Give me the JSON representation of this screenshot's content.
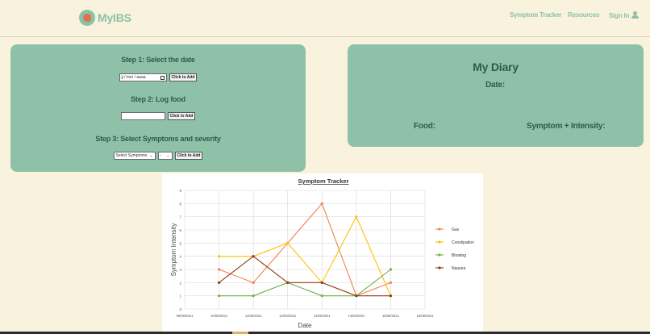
{
  "brand": {
    "name": "MyIBS"
  },
  "nav": {
    "symptom_tracker": "Symptom Tracker",
    "resources": "Resources",
    "sign_in": "Sign In"
  },
  "log_panel": {
    "step1_title": "Step 1: Select the date",
    "date_placeholder": "jj / mm / aaaa",
    "step1_button": "Click to Add",
    "step2_title": "Step 2: Log food",
    "food_value": "",
    "step2_button": "Click to Add",
    "step3_title": "Step 3: Select Symptoms and severity",
    "symptom_select": "Select Symptoms",
    "severity_select": "-",
    "step3_button": "Click to Add"
  },
  "diary": {
    "title": "My Diary",
    "date_label": "Date:",
    "food_label": "Food:",
    "symptom_label": "Symptom + Intensity:"
  },
  "chart_data": {
    "type": "line",
    "title": "Symptom Tracker",
    "xlabel": "Date",
    "ylabel": "Symptom Intensity",
    "x": [
      "09/09/2021",
      "10/09/2021",
      "11/09/2021",
      "12/09/2021",
      "13/09/2021",
      "14/09/2021",
      "15/09/2021",
      "16/09/2021"
    ],
    "ylim": [
      0,
      9
    ],
    "yticks": [
      "0",
      "1",
      "2",
      "3",
      "4",
      "5",
      "6",
      "7",
      "8",
      "9"
    ],
    "grid": true,
    "legend": "right",
    "series": [
      {
        "name": "Gas",
        "color": "#ed8350",
        "values": [
          null,
          3,
          2,
          5,
          8,
          1,
          2,
          null
        ]
      },
      {
        "name": "Constipation",
        "color": "#ffc000",
        "values": [
          null,
          4,
          4,
          5,
          2,
          7,
          1,
          null
        ]
      },
      {
        "name": "Bloating",
        "color": "#70ad47",
        "values": [
          null,
          1,
          1,
          2,
          1,
          1,
          3,
          null
        ]
      },
      {
        "name": "Nausea",
        "color": "#8b3a12",
        "values": [
          null,
          2,
          4,
          2,
          2,
          1,
          1,
          null
        ]
      }
    ]
  }
}
